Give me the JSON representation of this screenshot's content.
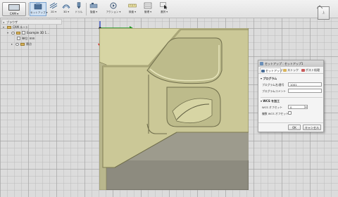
{
  "toolbar": {
    "workspace_label": "CAM ▾",
    "tools": [
      {
        "label": "セットアップ ▾"
      },
      {
        "label": "2D ▾"
      },
      {
        "label": "3D ▾"
      },
      {
        "label": "ドリル"
      },
      {
        "label": "旋盤 ▾"
      },
      {
        "label": "アクション ▾"
      },
      {
        "label": "検査 ▾"
      },
      {
        "label": "管理 ▾"
      },
      {
        "label": "選択 ▾"
      }
    ]
  },
  "browser": {
    "title": "ブラウザ",
    "items": [
      {
        "label": "CAM ルート"
      },
      {
        "label": "Example 3D 1…"
      },
      {
        "label": "単位: mm"
      },
      {
        "label": "原点"
      }
    ]
  },
  "viewcube": {
    "face_label": "上"
  },
  "dialog": {
    "title": "セットアップ : セットアップ1",
    "tabs": [
      {
        "label": "セットアップ"
      },
      {
        "label": "ストック"
      },
      {
        "label": "ポスト処理"
      }
    ],
    "program_section": "プログラム",
    "program_number_label": "プログラム名/番号",
    "program_number_value": "1001",
    "program_comment_label": "プログラムコメント",
    "program_comment_value": "",
    "wcs_section": "WCS を加工",
    "wcs_offset_label": "WCS オフセット",
    "wcs_offset_value": "0",
    "multiple_wcs_label": "複数 WCS オフセット",
    "ok_label": "OK",
    "cancel_label": "キャンセル"
  },
  "colors": {
    "model_face": "#d7d5a4",
    "model_shade": "#a9a678",
    "stock_box": "#8d8b7f",
    "selection_highlight": "#cfe0f2",
    "axis_y": "#1f9a1f",
    "axis_z": "#d22020",
    "axis_x": "#2040c0"
  }
}
